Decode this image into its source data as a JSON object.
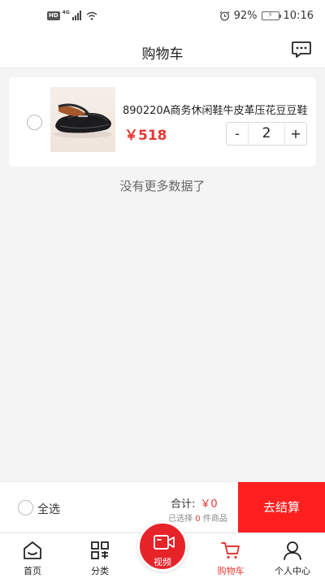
{
  "status_bar": {
    "hd_badge": "HD",
    "network": "4G",
    "battery_percent": "92%",
    "time": "10:16"
  },
  "header": {
    "title": "购物车",
    "message_icon": "chat-bubble-icon"
  },
  "cart": {
    "items": [
      {
        "title": "890220A商务休闲鞋牛皮革压花豆豆鞋",
        "price": "￥518",
        "quantity": "2",
        "minus_label": "-",
        "plus_label": "+",
        "image": "black-loafer-shoe"
      }
    ],
    "end_message": "没有更多数据了"
  },
  "checkout": {
    "select_all_label": "全选",
    "total_label": "合计:",
    "total_amount": "￥0",
    "selected_prefix": "已选择",
    "selected_count": "0",
    "selected_suffix": "件商品",
    "button_label": "去结算"
  },
  "tabbar": {
    "tabs": [
      {
        "label": "首页",
        "icon": "home-icon",
        "active": false
      },
      {
        "label": "分类",
        "icon": "category-grid-icon",
        "active": false
      },
      {
        "label": "视频",
        "icon": "video-camera-icon",
        "active": false
      },
      {
        "label": "购物车",
        "icon": "cart-icon",
        "active": true
      },
      {
        "label": "个人中心",
        "icon": "user-icon",
        "active": false
      }
    ]
  },
  "colors": {
    "accent_red": "#e53935",
    "checkout_red": "#ff1f1f",
    "fab_red": "#e7232a",
    "background": "#f4f4f4"
  }
}
